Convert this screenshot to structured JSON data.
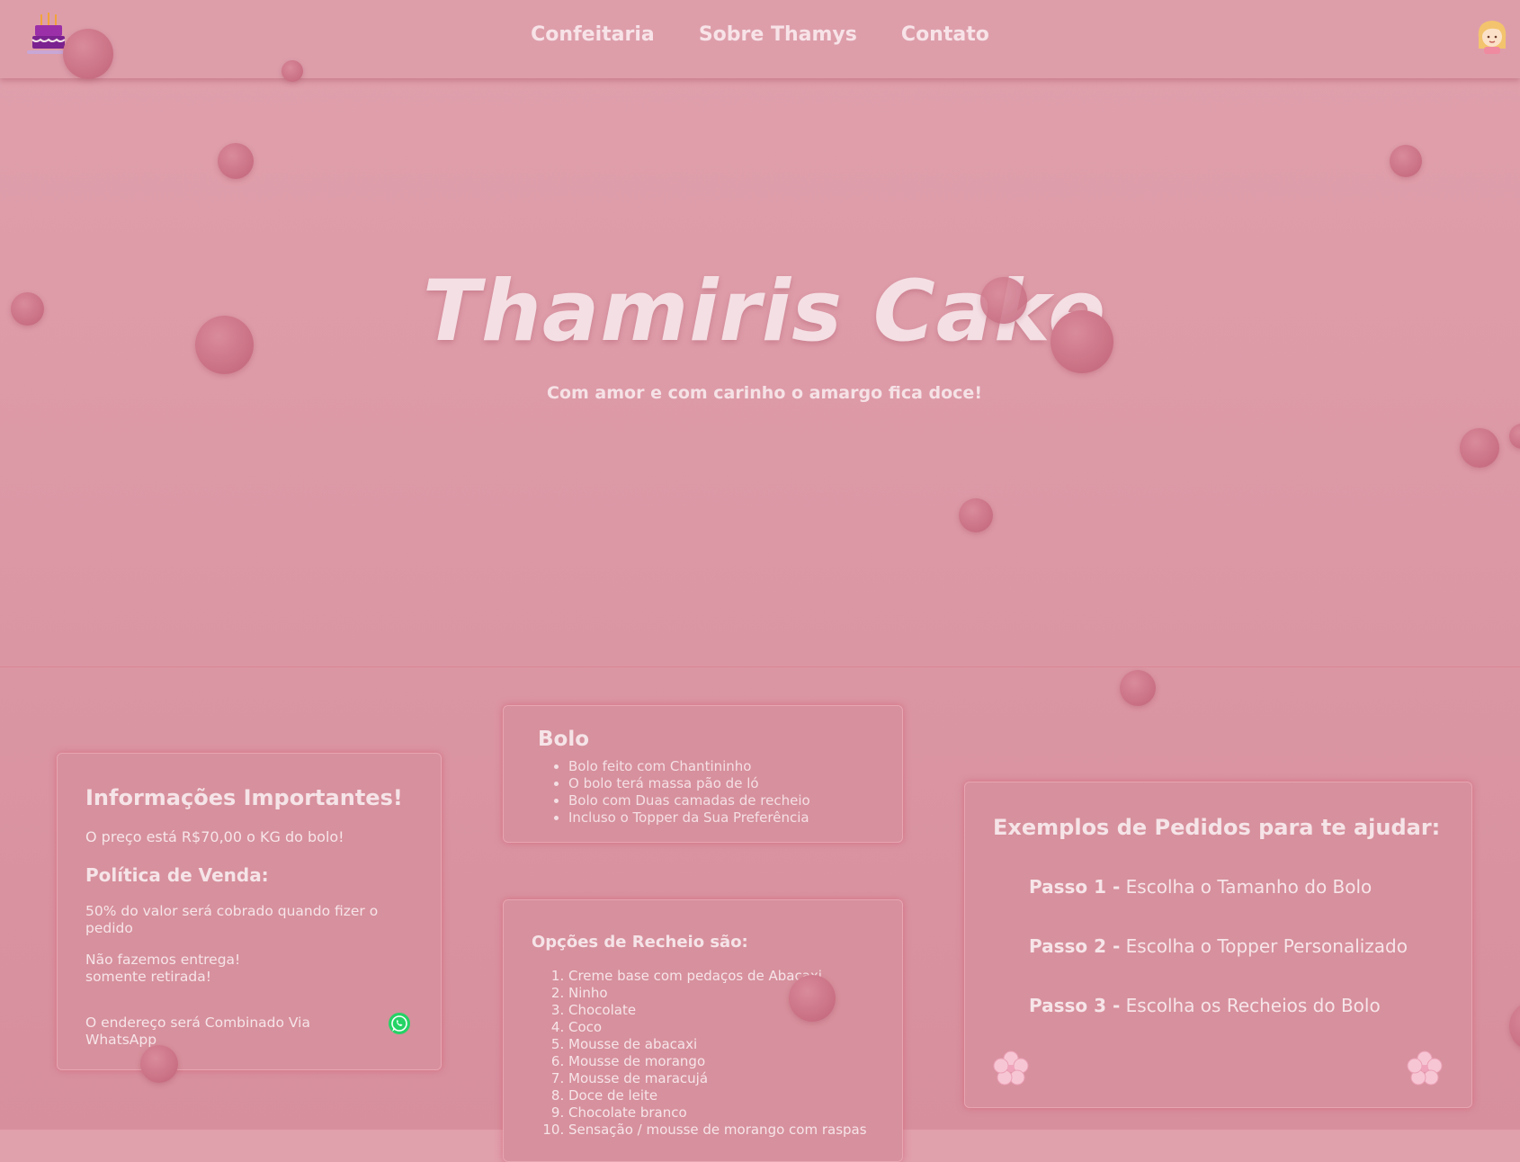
{
  "nav": {
    "links": [
      "Confeitaria",
      "Sobre Thamys",
      "Contato"
    ]
  },
  "hero": {
    "title": "Thamiris Cake",
    "subtitle": "Com amor e com carinho o amargo fica doce!"
  },
  "info": {
    "title": "Informações Importantes!",
    "price": "O preço está R$70,00 o KG do bolo!",
    "policy_title": "Política de Venda:",
    "policy_1": "50% do valor será cobrado quando fizer o pedido",
    "policy_2_line1": "Não fazemos entrega!",
    "policy_2_line2": "somente retirada!",
    "policy_3": "O endereço será Combinado Via WhatsApp"
  },
  "bolo": {
    "title": "Bolo",
    "items": [
      "Bolo feito com Chantininho",
      "O bolo terá massa pão de ló",
      "Bolo com Duas camadas de recheio",
      "Incluso o Topper da Sua Preferência"
    ]
  },
  "recheio": {
    "title": "Opções de Recheio são:",
    "items": [
      "Creme base com pedaços de Abacaxi.",
      "Ninho",
      "Chocolate",
      "Coco",
      "Mousse de abacaxi",
      "Mousse de morango",
      "Mousse de maracujá",
      "Doce de leite",
      "Chocolate branco",
      "Sensação / mousse de morango com raspas"
    ]
  },
  "examples": {
    "title": "Exemplos de Pedidos para te ajudar:",
    "steps": [
      {
        "label": "Passo 1 -",
        "text": "Escolha o Tamanho do Bolo"
      },
      {
        "label": "Passo 2 -",
        "text": "Escolha o Topper Personalizado"
      },
      {
        "label": "Passo 3 -",
        "text": "Escolha os Recheios do Bolo"
      }
    ]
  },
  "icons": {
    "logo": "cake-logo-icon",
    "avatar": "girl-avatar-icon",
    "whatsapp": "whatsapp-icon",
    "flower": "sakura-flower-icon"
  },
  "colors": {
    "background": "#dd9eaa",
    "card": "#d7909d",
    "bubble": "#c96f83",
    "text": "#f6e5e9",
    "whatsapp": "#25d366"
  }
}
